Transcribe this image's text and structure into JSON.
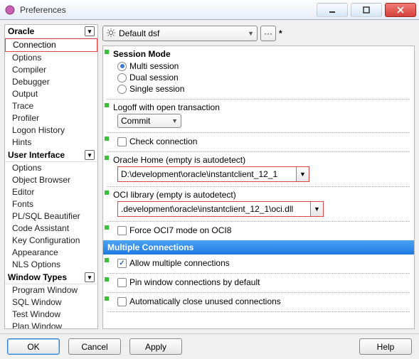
{
  "window": {
    "title": "Preferences"
  },
  "profile": {
    "selected": "Default dsf",
    "dirty_indicator": "*"
  },
  "tree": {
    "oracle": {
      "label": "Oracle",
      "items": [
        "Connection",
        "Options",
        "Compiler",
        "Debugger",
        "Output",
        "Trace",
        "Profiler",
        "Logon History",
        "Hints"
      ]
    },
    "ui": {
      "label": "User Interface",
      "items": [
        "Options",
        "Object Browser",
        "Editor",
        "Fonts",
        "PL/SQL Beautifier",
        "Code Assistant",
        "Key Configuration",
        "Appearance",
        "NLS Options"
      ]
    },
    "wt": {
      "label": "Window Types",
      "items": [
        "Program Window",
        "SQL Window",
        "Test Window",
        "Plan Window"
      ]
    }
  },
  "session_mode": {
    "label": "Session Mode",
    "opt_multi": "Multi session",
    "opt_dual": "Dual session",
    "opt_single": "Single session"
  },
  "logoff": {
    "label": "Logoff with open transaction",
    "value": "Commit"
  },
  "check_connection": {
    "label": "Check connection"
  },
  "oracle_home": {
    "label": "Oracle Home (empty is autodetect)",
    "value": "D:\\development\\oracle\\instantclient_12_1"
  },
  "oci": {
    "label": "OCI library (empty is autodetect)",
    "value": ".development\\oracle\\instantclient_12_1\\oci.dll"
  },
  "force_oci7": {
    "label": "Force OCI7 mode on OCI8"
  },
  "multi_conn": {
    "header": "Multiple Connections",
    "allow": "Allow multiple connections",
    "pin": "Pin window connections by default",
    "autoclose": "Automatically close unused connections"
  },
  "buttons": {
    "ok": "OK",
    "cancel": "Cancel",
    "apply": "Apply",
    "help": "Help"
  }
}
